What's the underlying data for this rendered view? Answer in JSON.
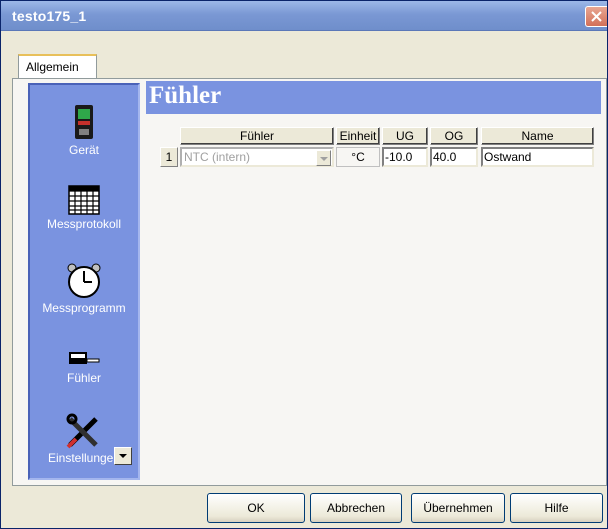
{
  "window": {
    "title": "testo175_1"
  },
  "tabs": [
    {
      "label": "Allgemein"
    }
  ],
  "sidebar": {
    "items": [
      {
        "label": "Gerät",
        "icon": "device-battery-icon"
      },
      {
        "label": "Messprotokoll",
        "icon": "grid-table-icon"
      },
      {
        "label": "Messprogramm",
        "icon": "stopwatch-icon"
      },
      {
        "label": "Fühler",
        "icon": "probe-icon"
      },
      {
        "label": "Einstellungen",
        "icon": "tools-icon"
      }
    ]
  },
  "section": {
    "title": "Fühler"
  },
  "table": {
    "columns": [
      "Fühler",
      "Einheit",
      "UG",
      "OG",
      "Name"
    ],
    "rows": [
      {
        "index": "1",
        "probe": "NTC (intern)",
        "unit": "°C",
        "ug": "-10.0",
        "og": "40.0",
        "name": "Ostwand"
      }
    ]
  },
  "buttons": {
    "ok": "OK",
    "cancel": "Abbrechen",
    "apply": "Übernehmen",
    "help": "Hilfe"
  },
  "colors": {
    "panel_blue": "#7a93e0",
    "window_face": "#ece9d8",
    "title_gradient_top": "#9cb8e8"
  }
}
